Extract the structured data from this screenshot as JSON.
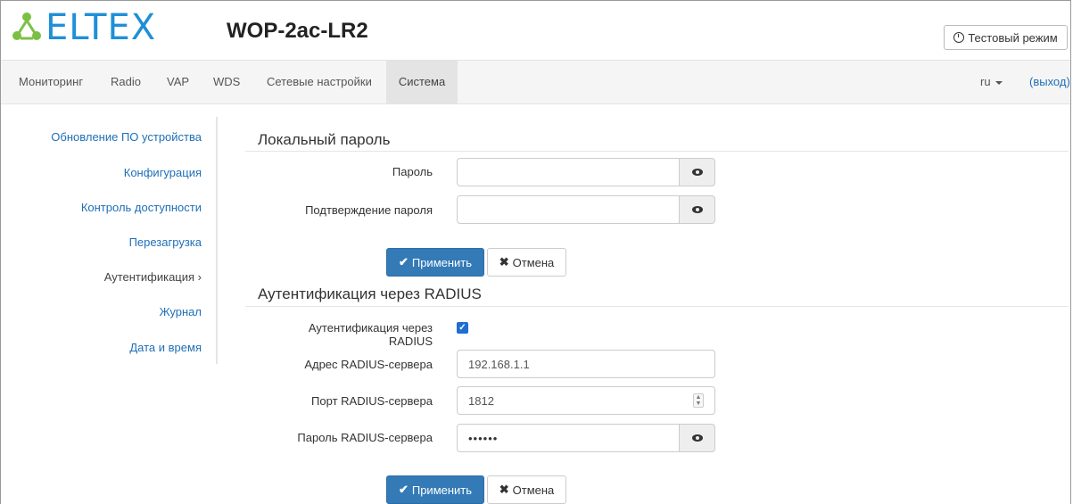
{
  "header": {
    "logo_text": "ELTEX",
    "model": "WOP-2ac-LR2",
    "test_mode_label": "Тестовый режим",
    "colors": {
      "logo_green": "#7bc043",
      "logo_blue": "#1f8fd8"
    }
  },
  "nav": {
    "items": [
      {
        "label": "Мониторинг"
      },
      {
        "label": "Radio"
      },
      {
        "label": "VAP"
      },
      {
        "label": "WDS"
      },
      {
        "label": "Сетевые настройки"
      },
      {
        "label": "Система"
      }
    ],
    "active": "Система",
    "lang": "ru",
    "logout": "(выход)"
  },
  "sidebar": {
    "items": [
      {
        "label": "Обновление ПО устройства"
      },
      {
        "label": "Конфигурация"
      },
      {
        "label": "Контроль доступности"
      },
      {
        "label": "Перезагрузка"
      },
      {
        "label": "Аутентификация ›"
      },
      {
        "label": "Журнал"
      },
      {
        "label": "Дата и время"
      }
    ],
    "active": "Аутентификация ›"
  },
  "local": {
    "title": "Локальный пароль",
    "password_label": "Пароль",
    "password_value": "",
    "confirm_label": "Подтверждение пароля",
    "confirm_value": "",
    "apply_label": "Применить",
    "cancel_label": "Отмена"
  },
  "radius": {
    "title": "Аутентификация через RADIUS",
    "enable_label": "Аутентификация через RADIUS",
    "enabled": true,
    "server_label": "Адрес RADIUS-сервера",
    "server_value": "192.168.1.1",
    "port_label": "Порт RADIUS-сервера",
    "port_value": "1812",
    "secret_label": "Пароль RADIUS-сервера",
    "secret_value": "••••••",
    "apply_label": "Применить",
    "cancel_label": "Отмена"
  },
  "colors": {
    "primary": "#337ab7",
    "link": "#1f6fb8"
  }
}
